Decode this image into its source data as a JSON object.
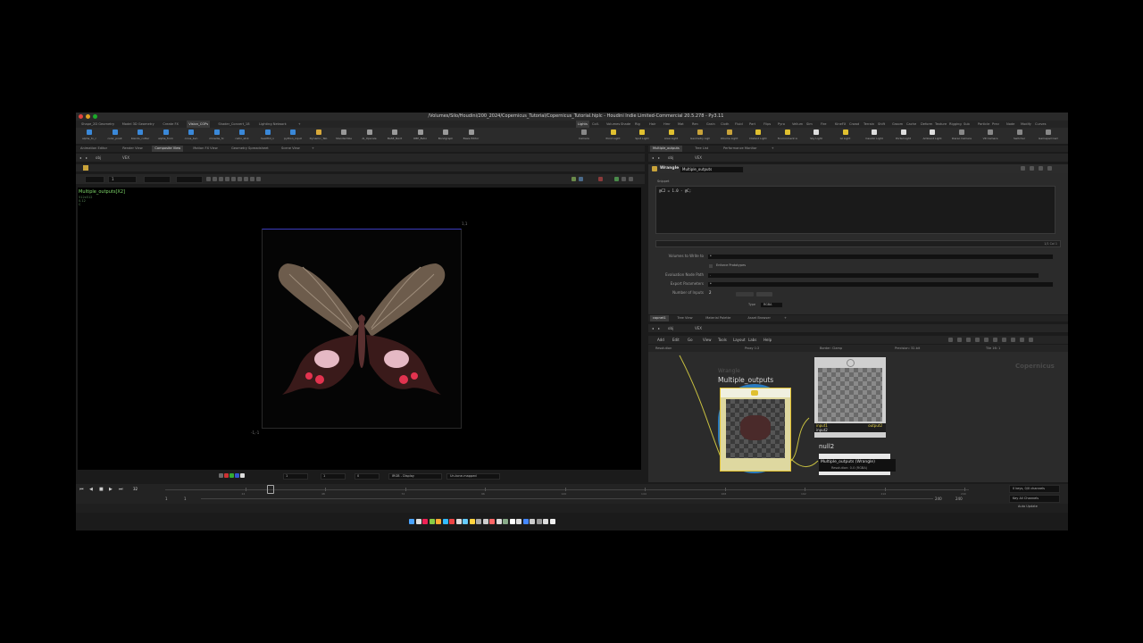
{
  "window": {
    "title": "/Volumes/Silo/Houdini/200_2024/Copernicus_Tutorial/Copernicus_Tutorial.hiplc - Houdini Indie Limited-Commercial 20.5.278 - Py3.11"
  },
  "shelf_tabs": [
    "Shape_2D Geometry",
    "Model 3D Geometry",
    "Create FX",
    "Vision_COPs",
    "Shader_Convert_18",
    "Lighting Network",
    "+"
  ],
  "shelf_tools": [
    "alpha_to_c",
    "color_posit",
    "blends_cutter",
    "alpha_from",
    "cross_bvn",
    "mixedie_fx",
    "radio_stck",
    "heatHill_n",
    "python_input",
    "Dynamic_Tab",
    "Standardize",
    "AI_Upscale",
    "BaSE_Nwrt",
    "OBP_Bvbo",
    "Bondgraph",
    "Basis Editor"
  ],
  "right_shelf_tabs": [
    "Lights",
    "Coll.",
    "Volumes",
    "Shade",
    "Rig",
    "Hair",
    "Hmr",
    "Mat",
    "Ren",
    "Grain",
    "Cloth",
    "Fluid",
    "Part",
    "Flips",
    "Pyro",
    "Vellum",
    "Sim",
    "Fire",
    "KineFX",
    "Crowd",
    "Terrain",
    "Shift",
    "Groom",
    "Cache",
    "Deform",
    "Texture",
    "Rigging",
    "Sub",
    "Particle",
    "Prev",
    "Node",
    "Modify",
    "Curves"
  ],
  "right_shelf_tools": [
    "Camera",
    "Point Light",
    "Spot Light",
    "Area Light",
    "Geometry Light",
    "Volume Light",
    "Distant Light",
    "Environment Light",
    "Sky Light",
    "GI Light",
    "Caustic Light",
    "Portal Light",
    "Ambient Light",
    "Stereo Camera",
    "VR Camera",
    "Switcher",
    "Gamepad Camera"
  ],
  "left_pane": {
    "tabs": [
      "Animation Editor",
      "Render View",
      "Composite View",
      "Motion FX View",
      "Geometry Spreadsheet",
      "Scene View",
      "+"
    ],
    "path": [
      "obj",
      "VEX"
    ],
    "node_label": "Multiple_outputs[X2]",
    "info_lines": [
      "512x512",
      "0.12",
      "C"
    ],
    "frame_input": "1",
    "coord_tl": "1,1",
    "coord_bl": "-1,-1",
    "display_lut": "IRGB - Display",
    "tone": "Un-tone-mapped",
    "bottom_vals": [
      "1",
      "1",
      "0"
    ]
  },
  "param_pane": {
    "tabs": [
      "Multiple_outputs",
      "Tree List",
      "Performance Monitor",
      "+"
    ],
    "path": [
      "obj",
      "VEX"
    ],
    "node_type": "Wrangle",
    "node_name": "Multiple_outputs",
    "snippet_label": "Snippet",
    "snippet_code": "@C2 = 1.0 - @C;",
    "snippet_status": "1/1 Col 1",
    "params": [
      {
        "label": "Volumes to Write to",
        "value": "*"
      },
      {
        "label": "",
        "value": "Enforce Prototypes"
      },
      {
        "label": "Evaluation Node Path",
        "value": "."
      },
      {
        "label": "Export Parameters",
        "value": "*"
      },
      {
        "label": "Number of Inputs",
        "value": "2"
      }
    ],
    "clear_label": "Clear",
    "type_label": "Type",
    "type_value": "RGBA"
  },
  "network_pane": {
    "tabs": [
      "copnet1",
      "Tree View",
      "Material Palette",
      "Asset Browser",
      "+"
    ],
    "path": [
      "obj",
      "VEX"
    ],
    "menu": [
      "Add",
      "Edit",
      "Go",
      "View",
      "Tools",
      "Layout",
      "Labs",
      "Help"
    ],
    "info": [
      "Resolution",
      "Proxy 1:2",
      "Border: Clamp",
      "Precision: 32-bit",
      "Tile 16: 1"
    ],
    "context_label": "Copernicus",
    "node_type": "Wrangle",
    "node_name": "Multiple_outputs",
    "null_name": "null2",
    "port_in1": "input1",
    "port_in2": "input2",
    "port_out": "output2",
    "tooltip_title": "Multiple_outputs (Wrangle)",
    "tooltip_sub": "Resolution: 0-0 (RGBA)"
  },
  "timeline": {
    "frame": "32",
    "start": "1",
    "start2": "1",
    "end": "240",
    "end2": "240",
    "keys_label": "0 keys, 0/0 channels",
    "key_all": "Key All Channels",
    "auto_update": "Auto Update",
    "ticks": [
      "24",
      "48",
      "72",
      "96",
      "120",
      "144",
      "168",
      "192",
      "216",
      "240"
    ]
  },
  "colors": {
    "accent_green": "#7fd86a",
    "node_selected": "#2a7bc0",
    "node_flag": "#e0c030",
    "wire": "#c8c040"
  }
}
